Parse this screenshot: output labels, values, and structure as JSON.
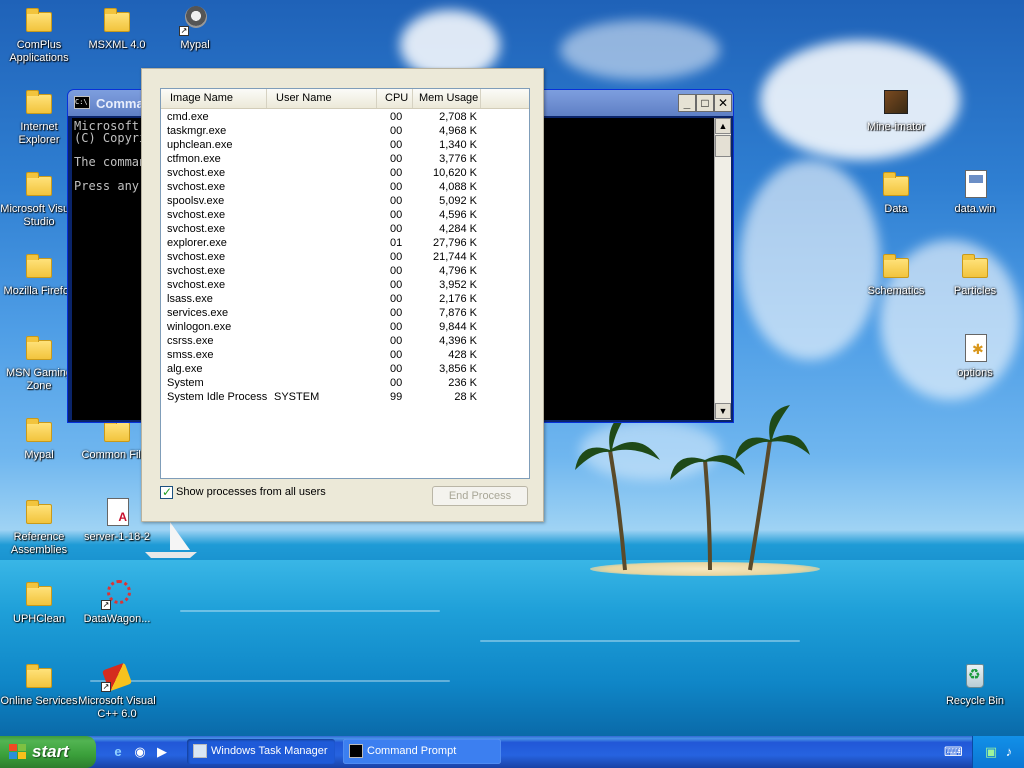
{
  "desktop": {
    "icons": [
      {
        "label": "ComPlus Applications",
        "kind": "folder"
      },
      {
        "label": "MSXML 4.0",
        "kind": "folder"
      },
      {
        "label": "Mypal",
        "kind": "raccoon"
      },
      {
        "label": "Internet Explorer",
        "kind": "folder"
      },
      {
        "label": "Microsoft Visual Studio",
        "kind": "folder"
      },
      {
        "label": "Mozilla Firefox",
        "kind": "folder"
      },
      {
        "label": "MSN Gaming Zone",
        "kind": "folder"
      },
      {
        "label": "Mypal",
        "kind": "folder"
      },
      {
        "label": "Common Files",
        "kind": "folder"
      },
      {
        "label": "Reference Assemblies",
        "kind": "folder"
      },
      {
        "label": "server-1-18-2",
        "kind": "serverdoc"
      },
      {
        "label": "UPHClean",
        "kind": "folder"
      },
      {
        "label": "DataWagon...",
        "kind": "wagon"
      },
      {
        "label": "Online Services",
        "kind": "folder"
      },
      {
        "label": "Microsoft Visual C++ 6.0",
        "kind": "vcpp"
      },
      {
        "label": "Mine-imator",
        "kind": "box3d"
      },
      {
        "label": "Data",
        "kind": "folder"
      },
      {
        "label": "data.win",
        "kind": "webdoc"
      },
      {
        "label": "Schematics",
        "kind": "folder"
      },
      {
        "label": "Particles",
        "kind": "folder"
      },
      {
        "label": "options",
        "kind": "gearicon"
      },
      {
        "label": "Recycle Bin",
        "kind": "recycle"
      }
    ]
  },
  "cmd_window": {
    "title": "Command Prompt",
    "lines": [
      "Microsoft Windows XP [Version 5.1.2600]",
      "(C) Copyright 1985-2001 Microsoft Corp.",
      "",
      "The command completed successfully.",
      "",
      "Press any key to continue . . ."
    ]
  },
  "task_manager": {
    "columns": [
      "Image Name",
      "User Name",
      "CPU",
      "Mem Usage"
    ],
    "processes": [
      {
        "name": "cmd.exe",
        "user": "",
        "cpu": "00",
        "mem": "2,708 K"
      },
      {
        "name": "taskmgr.exe",
        "user": "",
        "cpu": "00",
        "mem": "4,968 K"
      },
      {
        "name": "uphclean.exe",
        "user": "",
        "cpu": "00",
        "mem": "1,340 K"
      },
      {
        "name": "ctfmon.exe",
        "user": "",
        "cpu": "00",
        "mem": "3,776 K"
      },
      {
        "name": "svchost.exe",
        "user": "",
        "cpu": "00",
        "mem": "10,620 K"
      },
      {
        "name": "svchost.exe",
        "user": "",
        "cpu": "00",
        "mem": "4,088 K"
      },
      {
        "name": "spoolsv.exe",
        "user": "",
        "cpu": "00",
        "mem": "5,092 K"
      },
      {
        "name": "svchost.exe",
        "user": "",
        "cpu": "00",
        "mem": "4,596 K"
      },
      {
        "name": "svchost.exe",
        "user": "",
        "cpu": "00",
        "mem": "4,284 K"
      },
      {
        "name": "explorer.exe",
        "user": "",
        "cpu": "01",
        "mem": "27,796 K"
      },
      {
        "name": "svchost.exe",
        "user": "",
        "cpu": "00",
        "mem": "21,744 K"
      },
      {
        "name": "svchost.exe",
        "user": "",
        "cpu": "00",
        "mem": "4,796 K"
      },
      {
        "name": "svchost.exe",
        "user": "",
        "cpu": "00",
        "mem": "3,952 K"
      },
      {
        "name": "lsass.exe",
        "user": "",
        "cpu": "00",
        "mem": "2,176 K"
      },
      {
        "name": "services.exe",
        "user": "",
        "cpu": "00",
        "mem": "7,876 K"
      },
      {
        "name": "winlogon.exe",
        "user": "",
        "cpu": "00",
        "mem": "9,844 K"
      },
      {
        "name": "csrss.exe",
        "user": "",
        "cpu": "00",
        "mem": "4,396 K"
      },
      {
        "name": "smss.exe",
        "user": "",
        "cpu": "00",
        "mem": "428 K"
      },
      {
        "name": "alg.exe",
        "user": "",
        "cpu": "00",
        "mem": "3,856 K"
      },
      {
        "name": "System",
        "user": "",
        "cpu": "00",
        "mem": "236 K"
      },
      {
        "name": "System Idle Process",
        "user": "SYSTEM",
        "cpu": "99",
        "mem": "28 K"
      }
    ],
    "show_all_label": "Show processes from all users",
    "show_all_checked": true,
    "end_process_label": "End Process"
  },
  "taskbar": {
    "start_label": "start",
    "tasks": [
      {
        "label": "Windows Task Manager",
        "icon": "taskmgr-icon"
      },
      {
        "label": "Command Prompt",
        "icon": "cmd-icon"
      }
    ]
  },
  "colors": {
    "xp_blue": "#2157d7",
    "start_green": "#3a9f3a",
    "dialog_bg": "#ece9d8"
  }
}
